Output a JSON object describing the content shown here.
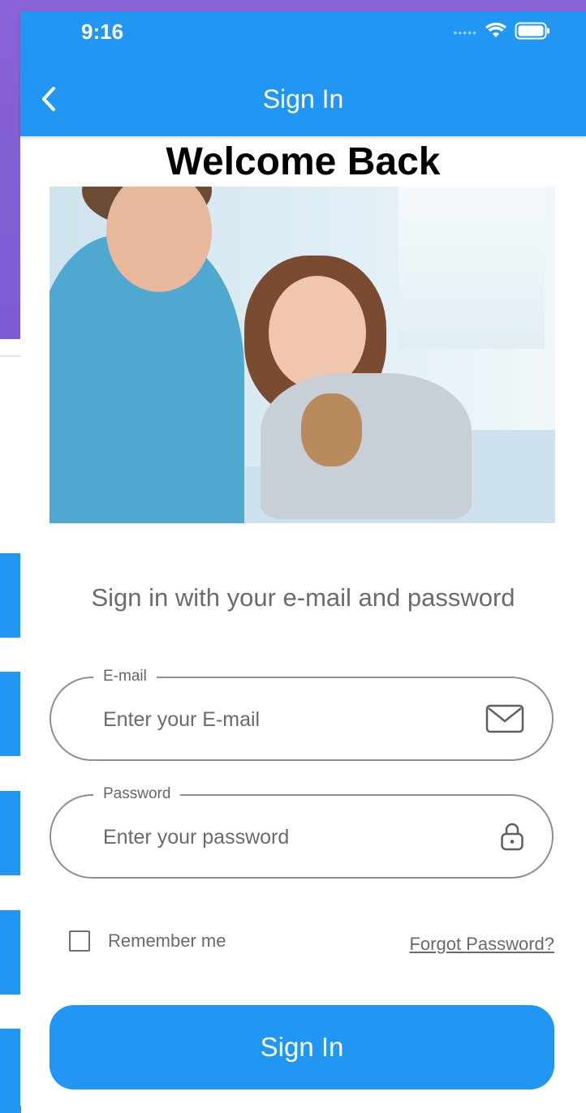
{
  "status_bar": {
    "time": "9:16",
    "icons": [
      "signal-dots-icon",
      "wifi-icon",
      "battery-icon"
    ]
  },
  "app_bar": {
    "title": "Sign In",
    "back_icon": "chevron-left-icon"
  },
  "heading": "Welcome Back",
  "subtitle": "Sign in with your e-mail and password",
  "email_field": {
    "label": "E-mail",
    "placeholder": "Enter your E-mail",
    "value": "",
    "icon": "mail-icon"
  },
  "password_field": {
    "label": "Password",
    "placeholder": "Enter your password",
    "value": "",
    "icon": "lock-icon"
  },
  "remember": {
    "label": "Remember me",
    "checked": false
  },
  "forgot_password": "Forgot Password?",
  "sign_in_button": "Sign In",
  "colors": {
    "primary": "#2196f3",
    "background_app": "#8a63d6",
    "text_muted": "#6a6a6a"
  }
}
